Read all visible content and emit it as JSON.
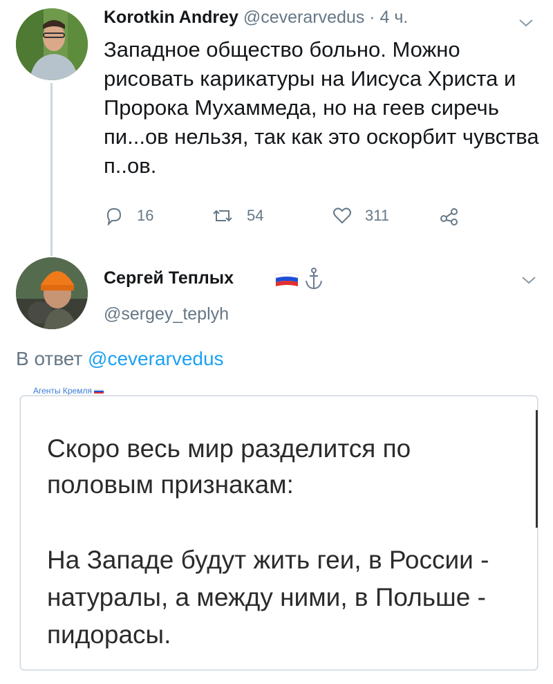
{
  "tweet1": {
    "author": "Korotkin Andrey",
    "handle": "@ceverarvedus",
    "time": "· 4 ч.",
    "text": "Западное общество больно. Можно рисовать карикатуры на Иисуса Христа и Пророка Мухаммеда, но на геев сиречь пи...ов нельзя, так как это оскорбит чувства п..ов.",
    "replies": "16",
    "retweets": "54",
    "likes": "311"
  },
  "tweet2": {
    "author": "Сергей Теплых",
    "handle": "@sergey_teplyh",
    "reply_prefix": "В ответ",
    "reply_handle": "@ceverarvedus",
    "image": {
      "watermark": "Агенты Кремля",
      "paragraph1": "Скоро весь мир разделится по половым признакам:",
      "paragraph2": "На Западе будут жить геи, в России - натуралы, а между ними, в Польше - пидорасы."
    }
  },
  "colors": {
    "text": "#14171a",
    "muted": "#657786",
    "link": "#1da1f2",
    "thread_line": "#ccd6dd"
  },
  "icons": [
    "reply-icon",
    "retweet-icon",
    "like-icon",
    "share-icon",
    "chevron-down-icon",
    "anchor-icon",
    "russian-flag-icon"
  ]
}
